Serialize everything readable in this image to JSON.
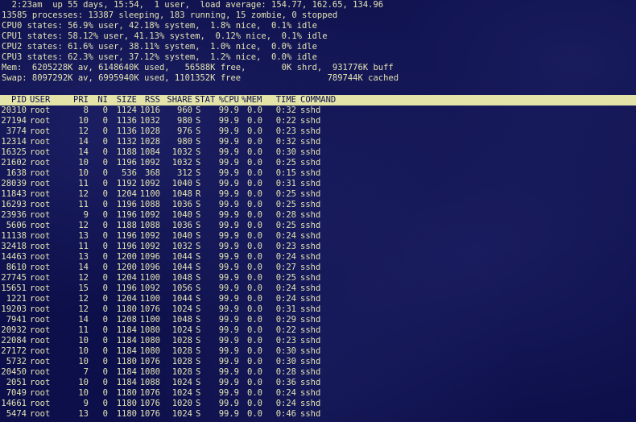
{
  "summary": {
    "uptime": "  2:23am  up 55 days, 15:54,  1 user,  load average: 154.77, 162.65, 134.96",
    "processes": "13585 processes: 13387 sleeping, 183 running, 15 zombie, 0 stopped",
    "cpu0": "CPU0 states: 56.9% user, 42.18% system,  1.8% nice,  0.1% idle",
    "cpu1": "CPU1 states: 58.12% user, 41.13% system,  0.12% nice,  0.1% idle",
    "cpu2": "CPU2 states: 61.6% user, 38.11% system,  1.0% nice,  0.0% idle",
    "cpu3": "CPU3 states: 62.3% user, 37.12% system,  1.2% nice,  0.0% idle",
    "mem": "Mem:  6205228K av, 6148640K used,   56588K free,       0K shrd,  931776K buff",
    "swap": "Swap: 8097292K av, 6995940K used, 1101352K free                 789744K cached"
  },
  "columns": {
    "pid": "PID",
    "user": "USER",
    "pri": "PRI",
    "ni": "NI",
    "size": "SIZE",
    "rss": "RSS",
    "share": "SHARE",
    "stat": "STAT",
    "cpu": "%CPU",
    "mem": "%MEM",
    "time": "TIME",
    "command": "COMMAND"
  },
  "colors": {
    "background": "#0d0f4a",
    "text": "#e4e4b4",
    "header_bar": "#e4e4a8"
  },
  "processes": [
    {
      "pid": "20310",
      "user": "root",
      "pri": "8",
      "ni": "0",
      "size": "1124",
      "rss": "1016",
      "share": "960",
      "stat": "S",
      "cpu": "99.9",
      "mem": "0.0",
      "time": "0:32",
      "command": "sshd"
    },
    {
      "pid": "27194",
      "user": "root",
      "pri": "10",
      "ni": "0",
      "size": "1136",
      "rss": "1032",
      "share": "980",
      "stat": "S",
      "cpu": "99.9",
      "mem": "0.0",
      "time": "0:22",
      "command": "sshd"
    },
    {
      "pid": "3774",
      "user": "root",
      "pri": "12",
      "ni": "0",
      "size": "1136",
      "rss": "1028",
      "share": "976",
      "stat": "S",
      "cpu": "99.9",
      "mem": "0.0",
      "time": "0:23",
      "command": "sshd"
    },
    {
      "pid": "12314",
      "user": "root",
      "pri": "14",
      "ni": "0",
      "size": "1132",
      "rss": "1028",
      "share": "980",
      "stat": "S",
      "cpu": "99.9",
      "mem": "0.0",
      "time": "0:32",
      "command": "sshd"
    },
    {
      "pid": "16325",
      "user": "root",
      "pri": "14",
      "ni": "0",
      "size": "1188",
      "rss": "1084",
      "share": "1032",
      "stat": "S",
      "cpu": "99.9",
      "mem": "0.0",
      "time": "0:30",
      "command": "sshd"
    },
    {
      "pid": "21602",
      "user": "root",
      "pri": "10",
      "ni": "0",
      "size": "1196",
      "rss": "1092",
      "share": "1032",
      "stat": "S",
      "cpu": "99.9",
      "mem": "0.0",
      "time": "0:25",
      "command": "sshd"
    },
    {
      "pid": "1638",
      "user": "root",
      "pri": "10",
      "ni": "0",
      "size": "536",
      "rss": "368",
      "share": "312",
      "stat": "S",
      "cpu": "99.9",
      "mem": "0.0",
      "time": "0:15",
      "command": "sshd"
    },
    {
      "pid": "28039",
      "user": "root",
      "pri": "11",
      "ni": "0",
      "size": "1192",
      "rss": "1092",
      "share": "1040",
      "stat": "S",
      "cpu": "99.9",
      "mem": "0.0",
      "time": "0:31",
      "command": "sshd"
    },
    {
      "pid": "11843",
      "user": "root",
      "pri": "12",
      "ni": "0",
      "size": "1204",
      "rss": "1100",
      "share": "1048",
      "stat": "R",
      "cpu": "99.9",
      "mem": "0.0",
      "time": "0:25",
      "command": "sshd"
    },
    {
      "pid": "16293",
      "user": "root",
      "pri": "11",
      "ni": "0",
      "size": "1196",
      "rss": "1088",
      "share": "1036",
      "stat": "S",
      "cpu": "99.9",
      "mem": "0.0",
      "time": "0:25",
      "command": "sshd"
    },
    {
      "pid": "23936",
      "user": "root",
      "pri": "9",
      "ni": "0",
      "size": "1196",
      "rss": "1092",
      "share": "1040",
      "stat": "S",
      "cpu": "99.9",
      "mem": "0.0",
      "time": "0:28",
      "command": "sshd"
    },
    {
      "pid": "5606",
      "user": "root",
      "pri": "12",
      "ni": "0",
      "size": "1188",
      "rss": "1088",
      "share": "1036",
      "stat": "S",
      "cpu": "99.9",
      "mem": "0.0",
      "time": "0:25",
      "command": "sshd"
    },
    {
      "pid": "11138",
      "user": "root",
      "pri": "13",
      "ni": "0",
      "size": "1196",
      "rss": "1092",
      "share": "1040",
      "stat": "S",
      "cpu": "99.9",
      "mem": "0.0",
      "time": "0:24",
      "command": "sshd"
    },
    {
      "pid": "32418",
      "user": "root",
      "pri": "11",
      "ni": "0",
      "size": "1196",
      "rss": "1092",
      "share": "1032",
      "stat": "S",
      "cpu": "99.9",
      "mem": "0.0",
      "time": "0:23",
      "command": "sshd"
    },
    {
      "pid": "14463",
      "user": "root",
      "pri": "13",
      "ni": "0",
      "size": "1200",
      "rss": "1096",
      "share": "1044",
      "stat": "S",
      "cpu": "99.9",
      "mem": "0.0",
      "time": "0:24",
      "command": "sshd"
    },
    {
      "pid": "8610",
      "user": "root",
      "pri": "14",
      "ni": "0",
      "size": "1200",
      "rss": "1096",
      "share": "1044",
      "stat": "S",
      "cpu": "99.9",
      "mem": "0.0",
      "time": "0:27",
      "command": "sshd"
    },
    {
      "pid": "27745",
      "user": "root",
      "pri": "12",
      "ni": "0",
      "size": "1204",
      "rss": "1100",
      "share": "1048",
      "stat": "S",
      "cpu": "99.9",
      "mem": "0.0",
      "time": "0:25",
      "command": "sshd"
    },
    {
      "pid": "15651",
      "user": "root",
      "pri": "15",
      "ni": "0",
      "size": "1196",
      "rss": "1092",
      "share": "1056",
      "stat": "S",
      "cpu": "99.9",
      "mem": "0.0",
      "time": "0:24",
      "command": "sshd"
    },
    {
      "pid": "1221",
      "user": "root",
      "pri": "12",
      "ni": "0",
      "size": "1204",
      "rss": "1100",
      "share": "1044",
      "stat": "S",
      "cpu": "99.9",
      "mem": "0.0",
      "time": "0:24",
      "command": "sshd"
    },
    {
      "pid": "19203",
      "user": "root",
      "pri": "12",
      "ni": "0",
      "size": "1180",
      "rss": "1076",
      "share": "1024",
      "stat": "S",
      "cpu": "99.9",
      "mem": "0.0",
      "time": "0:31",
      "command": "sshd"
    },
    {
      "pid": "7941",
      "user": "root",
      "pri": "14",
      "ni": "0",
      "size": "1208",
      "rss": "1100",
      "share": "1048",
      "stat": "S",
      "cpu": "99.9",
      "mem": "0.0",
      "time": "0:29",
      "command": "sshd"
    },
    {
      "pid": "20932",
      "user": "root",
      "pri": "11",
      "ni": "0",
      "size": "1184",
      "rss": "1080",
      "share": "1024",
      "stat": "S",
      "cpu": "99.9",
      "mem": "0.0",
      "time": "0:22",
      "command": "sshd"
    },
    {
      "pid": "22084",
      "user": "root",
      "pri": "10",
      "ni": "0",
      "size": "1184",
      "rss": "1080",
      "share": "1028",
      "stat": "S",
      "cpu": "99.9",
      "mem": "0.0",
      "time": "0:23",
      "command": "sshd"
    },
    {
      "pid": "27172",
      "user": "root",
      "pri": "10",
      "ni": "0",
      "size": "1184",
      "rss": "1080",
      "share": "1028",
      "stat": "S",
      "cpu": "99.9",
      "mem": "0.0",
      "time": "0:30",
      "command": "sshd"
    },
    {
      "pid": "5732",
      "user": "root",
      "pri": "10",
      "ni": "0",
      "size": "1180",
      "rss": "1076",
      "share": "1028",
      "stat": "S",
      "cpu": "99.9",
      "mem": "0.0",
      "time": "0:30",
      "command": "sshd"
    },
    {
      "pid": "20450",
      "user": "root",
      "pri": "7",
      "ni": "0",
      "size": "1184",
      "rss": "1080",
      "share": "1028",
      "stat": "S",
      "cpu": "99.9",
      "mem": "0.0",
      "time": "0:28",
      "command": "sshd"
    },
    {
      "pid": "2051",
      "user": "root",
      "pri": "10",
      "ni": "0",
      "size": "1184",
      "rss": "1088",
      "share": "1024",
      "stat": "S",
      "cpu": "99.9",
      "mem": "0.0",
      "time": "0:36",
      "command": "sshd"
    },
    {
      "pid": "7049",
      "user": "root",
      "pri": "10",
      "ni": "0",
      "size": "1180",
      "rss": "1076",
      "share": "1024",
      "stat": "S",
      "cpu": "99.9",
      "mem": "0.0",
      "time": "0:24",
      "command": "sshd"
    },
    {
      "pid": "14661",
      "user": "root",
      "pri": "9",
      "ni": "0",
      "size": "1180",
      "rss": "1076",
      "share": "1020",
      "stat": "S",
      "cpu": "99.9",
      "mem": "0.0",
      "time": "0:24",
      "command": "sshd"
    },
    {
      "pid": "5474",
      "user": "root",
      "pri": "13",
      "ni": "0",
      "size": "1180",
      "rss": "1076",
      "share": "1024",
      "stat": "S",
      "cpu": "99.9",
      "mem": "0.0",
      "time": "0:46",
      "command": "sshd"
    }
  ]
}
